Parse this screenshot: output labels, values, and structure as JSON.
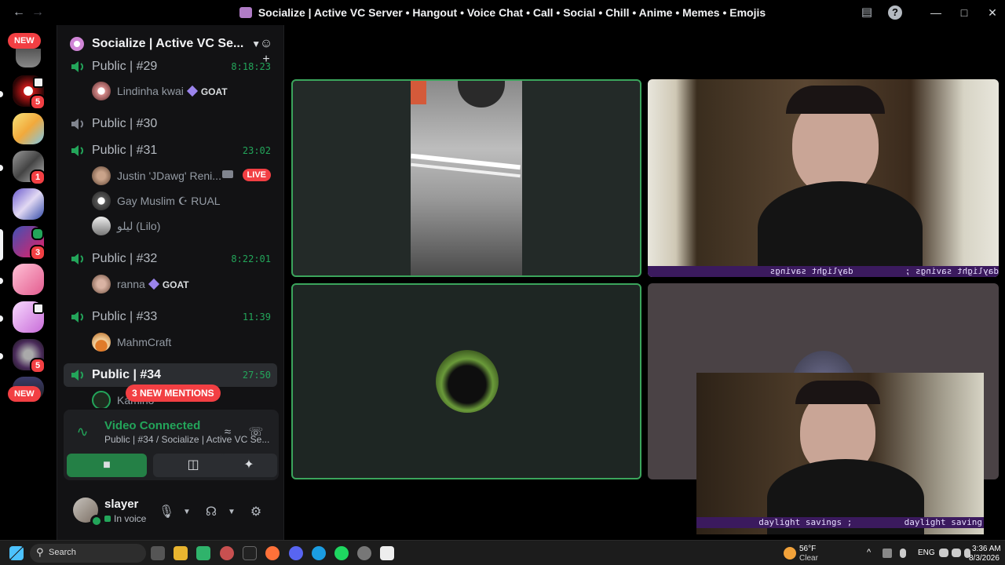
{
  "window": {
    "title": "Socialize | Active VC Server • Hangout • Voice Chat • Call • Social • Chill • Anime • Memes • Emojis"
  },
  "rail": {
    "new_label_top": "NEW",
    "new_label_bottom": "NEW",
    "badges": [
      "5",
      "1",
      "3",
      "5"
    ]
  },
  "guild": {
    "name": "Socialize | Active VC Se..."
  },
  "channels": [
    {
      "name": "Public | #29",
      "time": "8:18:23",
      "users": [
        {
          "name": "Lindinha kwai",
          "tag": "GOAT"
        }
      ]
    },
    {
      "name": "Public | #30",
      "time": "",
      "users": []
    },
    {
      "name": "Public | #31",
      "time": "23:02",
      "users": [
        {
          "name": "Justin 'JDawg' Reni...",
          "live": "LIVE"
        },
        {
          "name": "Gay Muslim ☪ RUAL"
        },
        {
          "name": "ليلو (Lilo)"
        }
      ]
    },
    {
      "name": "Public | #32",
      "time": "8:22:01",
      "users": [
        {
          "name": "ranna",
          "tag": "GOAT"
        }
      ]
    },
    {
      "name": "Public | #33",
      "time": "11:39",
      "users": [
        {
          "name": "MahmCraft"
        }
      ]
    },
    {
      "name": "Public | #34",
      "time": "27:50",
      "users": [
        {
          "name": "Kamino"
        }
      ]
    }
  ],
  "mentions_label": "3 NEW MENTIONS",
  "voice": {
    "status": "Video Connected",
    "channel": "Public | #34 / Socialize | Active VC Se..."
  },
  "me": {
    "name": "slayer",
    "status": "In voice"
  },
  "captions": {
    "tile2": "daylight savings ;          daylight savings",
    "pip": "daylight savings ;          daylight saving"
  },
  "taskbar": {
    "search": "Search",
    "weather_temp": "56°F",
    "weather_desc": "Clear",
    "lang": "ENG",
    "time": "3:36 AM",
    "date": "8/3/2026"
  }
}
